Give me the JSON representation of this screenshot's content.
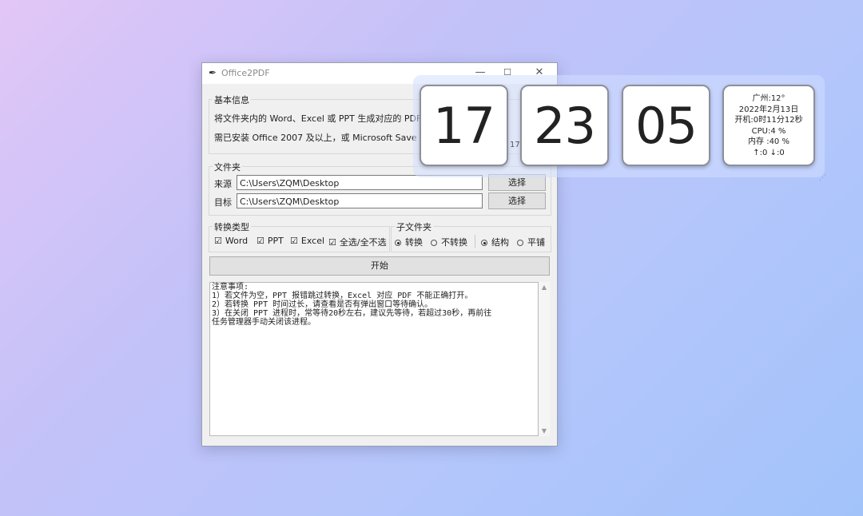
{
  "window": {
    "title": "Office2PDF",
    "controls": [
      "—",
      "☐",
      "✕"
    ]
  },
  "basic_info": {
    "label": "基本信息",
    "line1": "将文件夹内的 Word、Excel 或 PPT 生成对应的 PDF 文件",
    "line2": "需已安装 Office 2007 及以上，或 Microsoft Save as PDF"
  },
  "folder": {
    "label": "文件夹",
    "source_label": "来源",
    "source_value": "C:\\Users\\ZQM\\Desktop",
    "target_label": "目标",
    "target_value": "C:\\Users\\ZQM\\Desktop",
    "choose_label": "选择"
  },
  "convert_type": {
    "label": "转换类型",
    "items": [
      {
        "label": "Word",
        "checked": true
      },
      {
        "label": "PPT",
        "checked": true
      },
      {
        "label": "Excel",
        "checked": true
      },
      {
        "label": "全选/全不选",
        "checked": true
      }
    ]
  },
  "subfolder": {
    "label": "子文件夹",
    "convert": {
      "label": "转换",
      "selected": true
    },
    "no_convert": {
      "label": "不转换",
      "selected": false
    },
    "structure": {
      "label": "结构",
      "selected": true
    },
    "flat": {
      "label": "平铺",
      "selected": false
    }
  },
  "start_label": "开始",
  "notes": [
    "注意事项:",
    "1）若文件为空，PPT 报错跳过转换，Excel 对应 PDF 不能正确打开。",
    "2）若转换 PPT 时间过长，请查看是否有弹出窗口等待确认。",
    "3）在关闭 PPT 进程时，常等待20秒左右，建议先等待，若超过30秒，再前往",
    "任务管理器手动关闭该进程。"
  ],
  "clock": {
    "hour": "17",
    "minute": "23",
    "second": "05",
    "info": [
      "广州:12°",
      "2022年2月13日",
      "开机:0时11分12秒",
      "CPU:4 %",
      "内存 :40 %",
      "↑:0 ↓:0"
    ],
    "peek_text": "17."
  }
}
